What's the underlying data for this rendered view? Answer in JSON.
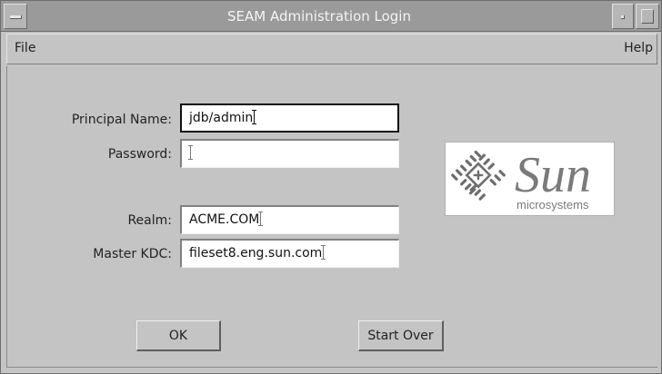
{
  "window": {
    "title": "SEAM Administration Login"
  },
  "menubar": {
    "file": "File",
    "help": "Help"
  },
  "form": {
    "principal": {
      "label": "Principal Name:",
      "value": "jdb/admin"
    },
    "password": {
      "label": "Password:",
      "value": ""
    },
    "realm": {
      "label": "Realm:",
      "value": "ACME.COM"
    },
    "kdc": {
      "label": "Master KDC:",
      "value": "fileset8.eng.sun.com"
    }
  },
  "logo": {
    "wordmark": "Sun",
    "tagline": "microsystems"
  },
  "buttons": {
    "ok": "OK",
    "start_over": "Start Over"
  },
  "colors": {
    "window_bg": "#c4c4c4",
    "titlebar_bg": "#9a9a9a",
    "field_bg": "#ffffff",
    "logo_gray": "#7a7a7a"
  }
}
